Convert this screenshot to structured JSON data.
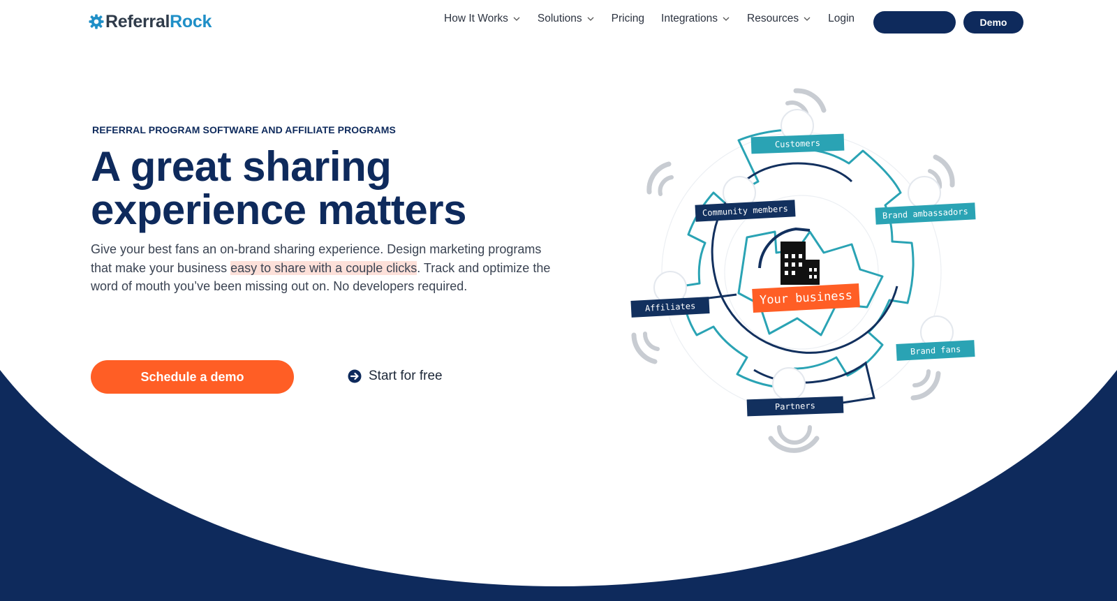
{
  "header": {
    "logo": {
      "part1": "Referral",
      "part2": "Rock"
    },
    "nav": [
      {
        "label": "How It Works",
        "has_dropdown": true
      },
      {
        "label": "Solutions",
        "has_dropdown": true
      },
      {
        "label": "Pricing",
        "has_dropdown": false
      },
      {
        "label": "Integrations",
        "has_dropdown": true
      },
      {
        "label": "Resources",
        "has_dropdown": true
      },
      {
        "label": "Login",
        "has_dropdown": false
      }
    ],
    "demo_button": "Demo"
  },
  "hero": {
    "eyebrow": "REFERRAL PROGRAM SOFTWARE AND AFFILIATE PROGRAMS",
    "title_line1": "A great sharing",
    "title_line2": "experience matters",
    "copy_before": "Give your best fans an on-brand sharing experience. Design marketing programs that make your business ",
    "copy_highlight": "easy to share with a couple clicks",
    "copy_after": ". Track and optimize the word of mouth you’ve been missing out on. No developers required.",
    "cta_primary": "Schedule a demo",
    "cta_secondary": "Start for free"
  },
  "diagram": {
    "center_label": "Your business",
    "nodes": {
      "customers": "Customers",
      "community": "Community members",
      "ambassadors": "Brand ambassadors",
      "affiliates": "Affiliates",
      "fans": "Brand fans",
      "partners": "Partners"
    }
  },
  "colors": {
    "navy": "#0e2a5c",
    "orange": "#ff5e25",
    "teal": "#2aa3b4",
    "highlight": "#fde0d9"
  }
}
